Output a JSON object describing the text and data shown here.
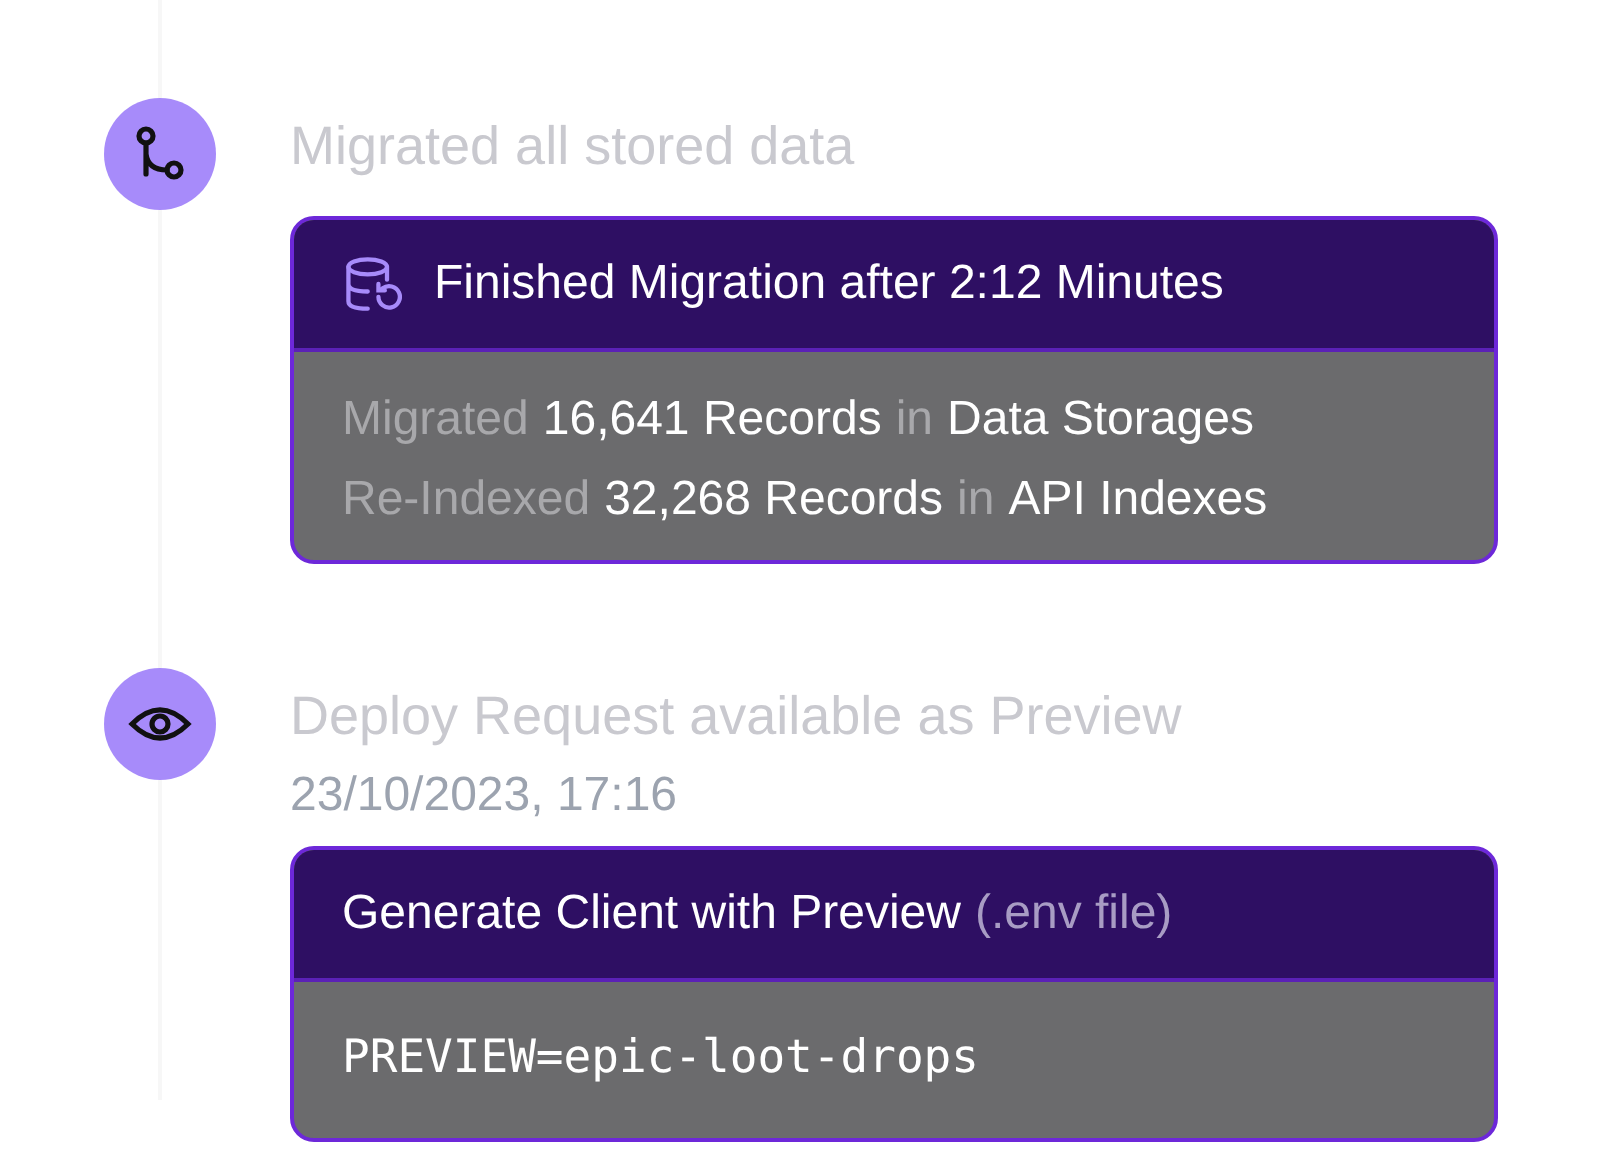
{
  "events": [
    {
      "title": "Migrated all stored data",
      "card": {
        "kind": "summary",
        "header": [
          {
            "text": "Finished Migration after 2:12 Minutes",
            "muted": false
          }
        ],
        "lines": [
          [
            {
              "text": "Migrated",
              "muted": true
            },
            {
              "text": "16,641 Records",
              "muted": false
            },
            {
              "text": "in",
              "muted": true
            },
            {
              "text": "Data Storages",
              "muted": false
            }
          ],
          [
            {
              "text": "Re-Indexed",
              "muted": true
            },
            {
              "text": "32,268 Records",
              "muted": false
            },
            {
              "text": "in",
              "muted": true
            },
            {
              "text": "API Indexes",
              "muted": false
            }
          ]
        ]
      }
    },
    {
      "title": "Deploy Request available as Preview",
      "date": "23/10/2023, 17:16",
      "card": {
        "kind": "code",
        "header": [
          {
            "text": "Generate Client with Preview",
            "muted": false
          },
          {
            "text": "(.env file)",
            "muted": true
          }
        ],
        "lines": [
          [
            {
              "text": "PREVIEW=epic-loot-drops",
              "muted": false
            }
          ]
        ]
      }
    }
  ]
}
